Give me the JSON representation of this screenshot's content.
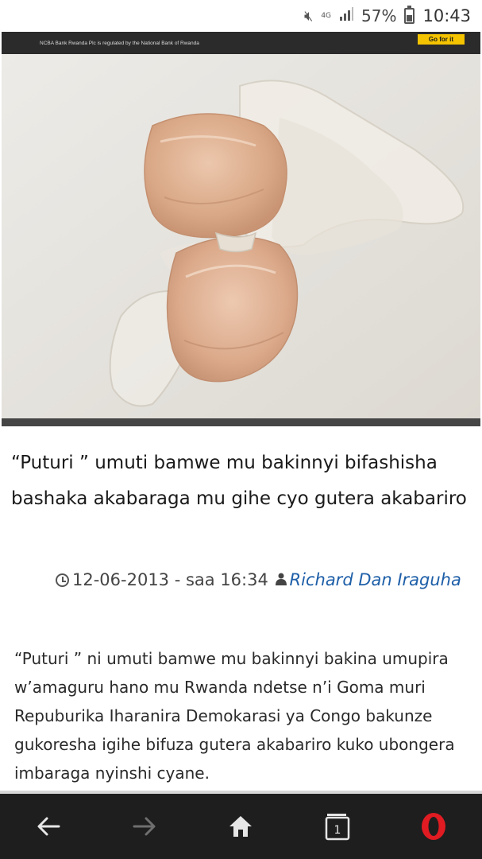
{
  "status_bar": {
    "network": "4G",
    "battery": "57%",
    "battery_level": 0.57,
    "time": "10:43"
  },
  "ad_banner": {
    "text": "NCBA Bank Rwanda Plc is regulated by the National Bank of Rwanda",
    "cta": "Go for it"
  },
  "article": {
    "title": "“Puturi ” umuti bamwe mu bakinnyi bifashisha bashaka akabaraga mu gihe cyo gutera akabariro",
    "date": "12-06-2013 - saa 16:34",
    "author": "Richard Dan Iraguha",
    "body": "“Puturi ” ni umuti bamwe mu bakinnyi bakina umupira w’amaguru hano mu Rwanda ndetse n’i Goma muri Repuburika Iharanira Demokarasi ya Congo bakunze gukoresha igihe bifuza gutera akabariro kuko ubongera imbaraga nyinshi cyane."
  },
  "bottom_nav": {
    "tab_count": "1",
    "icons": [
      "back-arrow-icon",
      "forward-arrow-icon",
      "home-icon",
      "tabs-icon",
      "opera-icon"
    ],
    "colors": {
      "background": "#1e1e1e",
      "icon": "#e6e6e6",
      "disabled": "#6f6f6f",
      "opera": "#e01b22"
    }
  }
}
